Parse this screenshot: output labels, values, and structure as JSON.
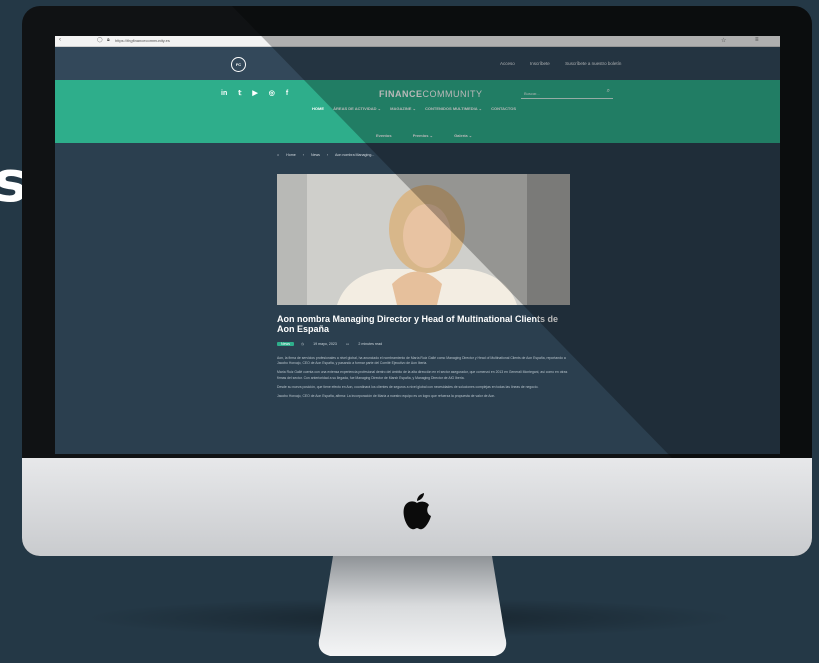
{
  "left_letter": "s",
  "browser": {
    "url": "https://thgfinancecommunity.es",
    "nav_icons": [
      "back-icon",
      "forward-icon"
    ],
    "star_icon": "star-icon",
    "menu_icon": "menu-icon"
  },
  "util_bar": {
    "logo_text": "FC",
    "links": [
      "Acceso",
      "Inscríbete",
      "Suscríbete a nuestro boletín"
    ]
  },
  "header": {
    "social_icons": [
      "linkedin-icon",
      "twitter-icon",
      "youtube-icon",
      "instagram-icon",
      "facebook-icon"
    ],
    "brand_bold": "FINANCE",
    "brand_light": "COMMUNITY",
    "search_placeholder": "Buscar...",
    "main_nav": [
      "HOME",
      "ÁREAS DE ACTIVIDAD ⌄",
      "MAGAZINE ⌄",
      "CONTENIDOS MULTIMEDIA ⌄",
      "CONTACTOS"
    ],
    "sub_nav": [
      "Eventos",
      "Premios ⌄",
      "Galería ⌄"
    ]
  },
  "breadcrumb": [
    "Home",
    "News",
    "Aon nombra Managing..."
  ],
  "article": {
    "title": "Aon nombra Managing Director y Head of Multinational Clients de Aon España",
    "tag": "News",
    "date": "19 mayo, 2023",
    "read_time": "2 minutes read",
    "paragraphs": [
      "Aon, la firma de servicios profesionales a nivel global, ha anunciado el nombramiento de María Ruiz Gallé como Managing Director y Head of Multinational Clients de Aon España, reportando a Jacobo Horcajo, CEO de Aon España, y pasando a formar parte del Comité Ejecutivo de Aon Iberia.",
      "María Ruiz Gallé cuenta con una extensa experiencia profesional dentro del ámbito de la alta dirección en el sector asegurador, que comenzó en 2013 en Generali Montegani, así como en otras firmas del sector. Con anterioridad a su llegada, fue Managing Director de Marsh España, y Managing Director de AIG Iberia.",
      "Desde su nueva posición, que tiene efecto en Aon, coordinará los clientes de seguros a nivel global con necesidades de soluciones complejas en todas las líneas de negocio.",
      "Jacobo Horcajo, CEO de Aon España, afirma: La incorporación de María a nuestro equipo es un logro que refuerza la propuesta de valor de Aon."
    ]
  }
}
